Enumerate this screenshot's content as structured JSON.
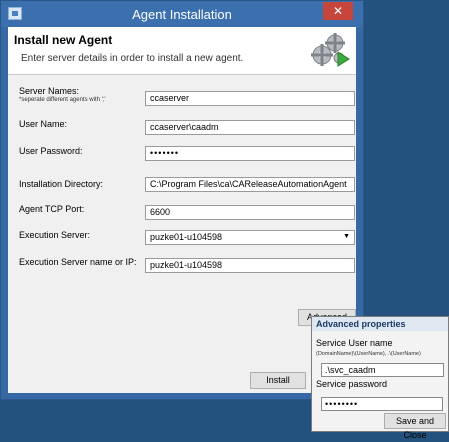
{
  "window": {
    "title": "Agent Installation",
    "close_glyph": "✕"
  },
  "header": {
    "title": "Install new Agent",
    "subtitle": "Enter server details in order to install a new agent.",
    "icon": "gears-play-icon"
  },
  "form": {
    "server_names": {
      "label": "Server Names:",
      "hint": "*seperate different agents with ';'",
      "value": "ccaserver"
    },
    "user_name": {
      "label": "User Name:",
      "value": "ccaserver\\caadm"
    },
    "user_password": {
      "label": "User Password:",
      "value": "•••••••"
    },
    "install_dir": {
      "label": "Installation Directory:",
      "value": "C:\\Program Files\\ca\\CAReleaseAutomationAgent"
    },
    "tcp_port": {
      "label": "Agent TCP Port:",
      "value": "6600"
    },
    "exec_server": {
      "label": "Execution Server:",
      "value": "puzke01-u104598"
    },
    "exec_server_ip": {
      "label": "Execution Server name or IP:",
      "value": "puzke01-u104598"
    }
  },
  "buttons": {
    "advanced": "Advanced",
    "install": "Install"
  },
  "advanced_popup": {
    "title": "Advanced properties",
    "user_label": "Service User name",
    "user_hint": "(DomainName)\\(UserName), .\\(UserName)",
    "user_value": ".\\svc_caadm",
    "password_label": "Service password",
    "password_value": "••••••••",
    "save_button": "Save and Close"
  },
  "colors": {
    "desktop": "#24527f",
    "window_frame": "#3568a4",
    "close": "#c7463c"
  }
}
